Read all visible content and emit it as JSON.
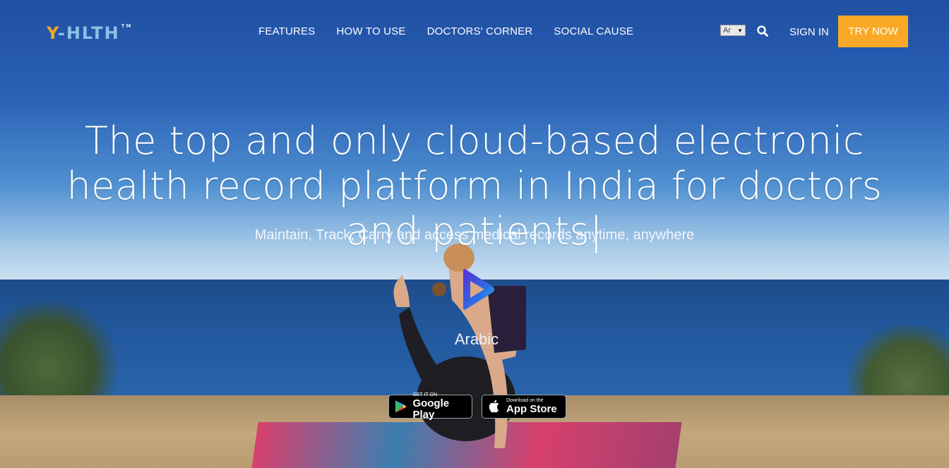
{
  "brand": {
    "name": "Y-HLTH",
    "y": "Y",
    "rest": "-HLTH",
    "tm": "TM",
    "accent": "#f9a925",
    "logo_blue": "#8ec0e8"
  },
  "nav": {
    "items": [
      {
        "label": "FEATURES"
      },
      {
        "label": "HOW TO USE"
      },
      {
        "label": "DOCTORS' CORNER"
      },
      {
        "label": "SOCIAL CAUSE"
      }
    ]
  },
  "header": {
    "language_selected": "Ar",
    "search_icon": "search-icon",
    "signin_label": "SIGN IN",
    "cta_label": "TRY NOW"
  },
  "hero": {
    "headline": "The top and only cloud-based electronic health record platform in India for doctors and patients|",
    "subheadline": "Maintain, Track, Carry and access medical records anytime, anywhere",
    "play_icon": "play-icon",
    "language_label": "Arabic"
  },
  "stores": {
    "google": {
      "small": "GET IT ON",
      "big": "Google Play"
    },
    "apple": {
      "small": "Download on the",
      "big": "App Store"
    }
  }
}
